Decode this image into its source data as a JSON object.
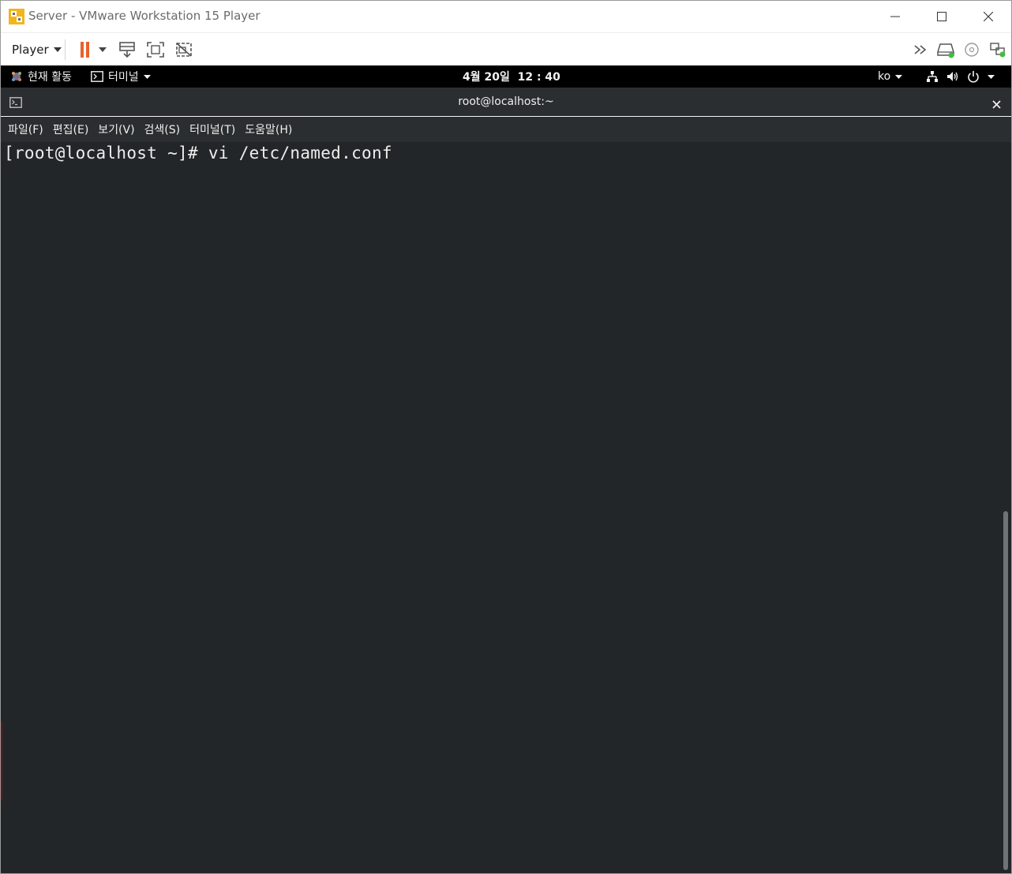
{
  "window": {
    "title": "Server - VMware Workstation 15 Player"
  },
  "toolbar": {
    "player_label": "Player",
    "icons": [
      "pause-icon",
      "send-ctrl-alt-del-icon",
      "fullscreen-icon",
      "unity-icon",
      "more-icon",
      "hard-disk-icon",
      "cd-dvd-icon",
      "network-adapter-icon"
    ],
    "accent_color": "#e8622a"
  },
  "gnome": {
    "activities": "현재 활동",
    "app_menu": "터미널",
    "clock": "4월 20일  12 : 40",
    "input_method": "ko"
  },
  "terminal": {
    "title": "root@localhost:~",
    "menus": [
      "파일(F)",
      "편집(E)",
      "보기(V)",
      "검색(S)",
      "터미널(T)",
      "도움말(H)"
    ],
    "line": "[root@localhost ~]# vi /etc/named.conf",
    "background": "#232629"
  }
}
